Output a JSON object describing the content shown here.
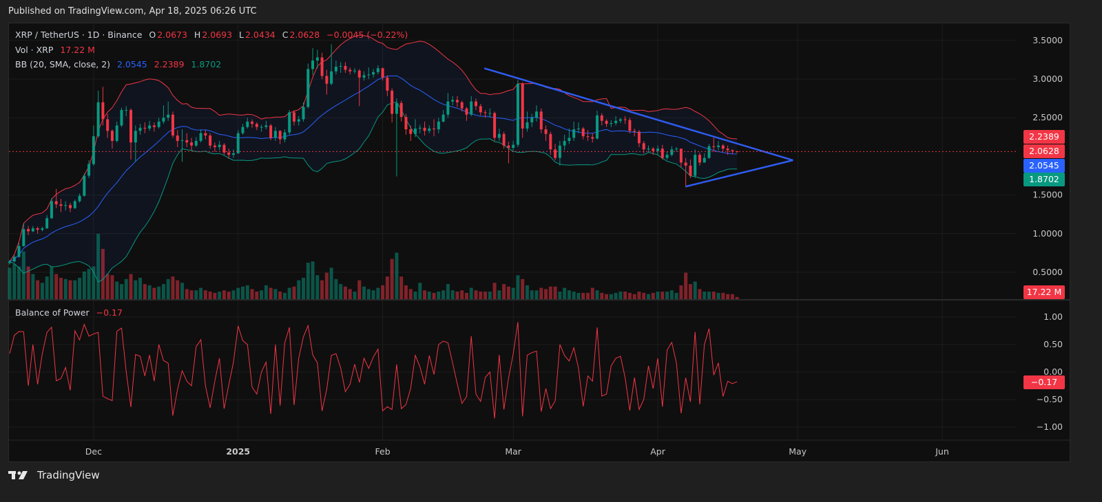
{
  "header": {
    "published": "Published on TradingView.com, Apr 18, 2025 06:26 UTC"
  },
  "legend": {
    "symbol": "XRP / TetherUS · 1D · Binance",
    "o_label": "O",
    "o_value": "2.0673",
    "h_label": "H",
    "h_value": "2.0693",
    "l_label": "L",
    "l_value": "2.0434",
    "c_label": "C",
    "c_value": "2.0628",
    "change": "−0.0045 (−0.22%)",
    "vol_label": "Vol · XRP",
    "vol_value": "17.22 M",
    "bb_label": "BB (20, SMA, close, 2)",
    "bb_basis": "2.0545",
    "bb_upper": "2.2389",
    "bb_lower": "1.8702",
    "bop_label": "Balance of Power",
    "bop_value": "−0.17"
  },
  "badges": {
    "upper": "2.2389",
    "close": "2.0628",
    "basis": "2.0545",
    "lower": "1.8702",
    "volume": "17.22 M",
    "bop": "−0.17"
  },
  "footer": {
    "brand": "TradingView"
  },
  "colors": {
    "up": "#089981",
    "down": "#f23645",
    "basis": "#2962ff",
    "trendline": "#2f5cf0"
  },
  "chart_data": {
    "type": "candlestick",
    "title": "XRP / TetherUS · 1D · Binance",
    "first_open": 0.62,
    "close": [
      0.64,
      0.7,
      0.84,
      1.06,
      1.03,
      1.07,
      1.05,
      1.07,
      1.2,
      1.42,
      1.38,
      1.36,
      1.37,
      1.33,
      1.42,
      1.49,
      1.75,
      1.9,
      2.26,
      2.7,
      2.48,
      2.33,
      2.2,
      2.4,
      2.6,
      2.6,
      2.18,
      2.33,
      2.37,
      2.36,
      2.4,
      2.38,
      2.45,
      2.5,
      2.54,
      2.27,
      2.2,
      2.21,
      2.18,
      2.14,
      2.2,
      2.3,
      2.27,
      2.14,
      2.12,
      2.15,
      2.05,
      2.02,
      2.04,
      2.3,
      2.38,
      2.45,
      2.42,
      2.38,
      2.38,
      2.4,
      2.24,
      2.33,
      2.22,
      2.31,
      2.57,
      2.45,
      2.48,
      2.64,
      3.13,
      3.24,
      3.28,
      3.04,
      2.94,
      3.1,
      3.16,
      3.17,
      3.12,
      3.1,
      3.11,
      3.02,
      3.05,
      3.06,
      3.09,
      3.14,
      3.02,
      2.85,
      2.55,
      2.69,
      2.51,
      2.35,
      2.29,
      2.36,
      2.37,
      2.33,
      2.36,
      2.35,
      2.45,
      2.54,
      2.71,
      2.73,
      2.7,
      2.62,
      2.54,
      2.71,
      2.65,
      2.57,
      2.56,
      2.56,
      2.24,
      2.29,
      2.14,
      2.11,
      2.15,
      2.94,
      2.36,
      2.44,
      2.5,
      2.58,
      2.35,
      2.29,
      2.09,
      1.98,
      2.14,
      2.2,
      2.24,
      2.35,
      2.36,
      2.26,
      2.25,
      2.23,
      2.53,
      2.46,
      2.42,
      2.43,
      2.46,
      2.48,
      2.47,
      2.33,
      2.32,
      2.17,
      2.09,
      2.1,
      2.07,
      2.1,
      1.98,
      2.02,
      2.09,
      2.1,
      1.92,
      1.88,
      1.75,
      2.02,
      1.92,
      1.98,
      2.13,
      2.12,
      2.14,
      2.1,
      2.08,
      2.0673,
      2.0628
    ],
    "high": [
      0.66,
      0.72,
      0.88,
      1.13,
      1.1,
      1.1,
      1.09,
      1.09,
      1.24,
      1.46,
      1.58,
      1.45,
      1.42,
      1.4,
      1.44,
      1.52,
      1.78,
      1.95,
      2.4,
      2.85,
      2.9,
      2.55,
      2.35,
      2.45,
      2.63,
      2.65,
      2.62,
      2.4,
      2.42,
      2.44,
      2.46,
      2.44,
      2.5,
      2.66,
      2.71,
      2.58,
      2.34,
      2.35,
      2.3,
      2.24,
      2.25,
      2.35,
      2.34,
      2.3,
      2.18,
      2.2,
      2.17,
      2.1,
      2.09,
      2.34,
      2.42,
      2.5,
      2.48,
      2.44,
      2.41,
      2.46,
      2.42,
      2.38,
      2.34,
      2.35,
      2.6,
      2.6,
      2.52,
      2.7,
      3.2,
      3.4,
      3.38,
      3.34,
      3.12,
      3.45,
      3.24,
      3.22,
      3.22,
      3.15,
      3.14,
      3.13,
      3.1,
      3.15,
      3.13,
      3.18,
      3.15,
      3.05,
      2.88,
      2.75,
      2.72,
      2.55,
      2.4,
      2.48,
      2.41,
      2.45,
      2.4,
      2.48,
      2.5,
      2.6,
      2.82,
      2.78,
      2.78,
      2.72,
      2.64,
      2.78,
      2.75,
      2.68,
      2.6,
      2.62,
      2.58,
      2.36,
      2.32,
      2.19,
      2.2,
      2.99,
      2.96,
      2.58,
      2.55,
      2.66,
      2.62,
      2.4,
      2.32,
      2.16,
      2.2,
      2.28,
      2.36,
      2.45,
      2.44,
      2.38,
      2.34,
      2.3,
      2.59,
      2.56,
      2.48,
      2.47,
      2.52,
      2.5,
      2.52,
      2.5,
      2.36,
      2.34,
      2.2,
      2.14,
      2.12,
      2.14,
      2.15,
      2.06,
      2.13,
      2.12,
      2.1,
      1.98,
      1.96,
      2.09,
      2.05,
      2.04,
      2.16,
      2.24,
      2.2,
      2.16,
      2.14,
      2.09,
      2.0693
    ],
    "low": [
      0.6,
      0.63,
      0.69,
      0.83,
      0.98,
      1.02,
      1.0,
      1.03,
      1.06,
      1.19,
      1.33,
      1.28,
      1.3,
      1.28,
      1.32,
      1.4,
      1.48,
      1.72,
      1.88,
      2.24,
      2.4,
      2.24,
      2.1,
      2.18,
      2.38,
      2.52,
      1.96,
      1.93,
      2.28,
      2.3,
      2.33,
      2.32,
      2.36,
      2.42,
      2.46,
      2.24,
      2.12,
      1.93,
      2.12,
      2.08,
      2.12,
      2.18,
      2.22,
      2.1,
      2.06,
      2.08,
      2.02,
      1.97,
      1.98,
      2.03,
      2.28,
      2.36,
      2.37,
      2.34,
      2.32,
      2.35,
      2.21,
      2.2,
      2.16,
      2.18,
      2.28,
      2.4,
      2.4,
      2.45,
      2.62,
      3.05,
      3.14,
      3.0,
      2.8,
      2.92,
      3.06,
      3.08,
      3.08,
      3.06,
      3.07,
      2.65,
      2.98,
      3.0,
      3.02,
      3.06,
      2.98,
      2.78,
      2.44,
      1.74,
      2.45,
      2.28,
      2.2,
      2.25,
      2.3,
      2.27,
      2.3,
      2.26,
      2.3,
      2.44,
      2.5,
      2.66,
      2.64,
      2.58,
      2.46,
      2.52,
      2.6,
      2.53,
      2.5,
      2.5,
      2.2,
      2.2,
      2.1,
      1.91,
      2.08,
      2.12,
      2.24,
      2.32,
      2.38,
      2.45,
      2.3,
      2.2,
      2.02,
      1.95,
      1.88,
      2.08,
      2.16,
      2.2,
      2.3,
      2.22,
      2.2,
      2.18,
      2.22,
      2.4,
      2.38,
      2.38,
      2.4,
      2.43,
      2.42,
      2.3,
      2.26,
      2.12,
      2.04,
      2.05,
      2.02,
      2.02,
      1.96,
      1.96,
      2.0,
      2.06,
      1.86,
      1.6,
      1.72,
      1.72,
      1.88,
      1.92,
      1.97,
      2.06,
      2.08,
      2.07,
      2.02,
      2.03,
      2.0434
    ],
    "volume_m": [
      250,
      280,
      260,
      380,
      260,
      200,
      150,
      130,
      180,
      260,
      200,
      170,
      160,
      150,
      150,
      170,
      220,
      240,
      260,
      520,
      400,
      200,
      190,
      140,
      120,
      160,
      200,
      150,
      170,
      120,
      110,
      90,
      100,
      120,
      160,
      180,
      150,
      130,
      80,
      70,
      70,
      90,
      70,
      60,
      50,
      60,
      70,
      60,
      70,
      90,
      100,
      110,
      80,
      60,
      70,
      110,
      90,
      80,
      60,
      50,
      90,
      100,
      150,
      170,
      290,
      300,
      190,
      150,
      210,
      250,
      160,
      120,
      100,
      80,
      60,
      150,
      100,
      80,
      70,
      90,
      110,
      180,
      320,
      370,
      180,
      110,
      80,
      60,
      130,
      70,
      60,
      50,
      60,
      70,
      120,
      70,
      60,
      70,
      50,
      90,
      70,
      60,
      60,
      60,
      130,
      70,
      120,
      100,
      90,
      190,
      160,
      110,
      70,
      70,
      90,
      80,
      100,
      100,
      60,
      90,
      70,
      60,
      50,
      50,
      50,
      90,
      70,
      50,
      40,
      40,
      50,
      60,
      60,
      50,
      40,
      60,
      50,
      40,
      50,
      60,
      60,
      60,
      70,
      50,
      110,
      210,
      120,
      140,
      80,
      60,
      60,
      60,
      50,
      50,
      40,
      40,
      17.22
    ],
    "indicators": {
      "bollinger": {
        "length": 20,
        "mult": 2,
        "basis": 2.0545,
        "upper": 2.2389,
        "lower": 1.8702
      },
      "balance_of_power_last": -0.17
    },
    "y_ticks": [
      "3.5000",
      "3.0000",
      "2.5000",
      "1.5000",
      "1.0000",
      "0.5000"
    ],
    "bop_ticks": [
      "1.00",
      "0.50",
      "0.00",
      "−0.50",
      "−1.00"
    ],
    "bop_tick_values": [
      1,
      0.5,
      0,
      -0.5,
      -1
    ],
    "ylim": [
      0.5,
      3.5
    ],
    "x_ticks": [
      {
        "label": "Dec",
        "day": 18,
        "bold": false
      },
      {
        "label": "2025",
        "day": 49,
        "bold": true
      },
      {
        "label": "Feb",
        "day": 80,
        "bold": false
      },
      {
        "label": "Mar",
        "day": 108,
        "bold": false
      },
      {
        "label": "Apr",
        "day": 139,
        "bold": false
      },
      {
        "label": "May",
        "day": 169,
        "bold": false
      },
      {
        "label": "Jun",
        "day": 200,
        "bold": false
      }
    ],
    "trendlines": [
      {
        "from": {
          "day": 101.8,
          "price": 3.14
        },
        "to": {
          "day": 168,
          "price": 1.95
        }
      },
      {
        "from": {
          "day": 145,
          "price": 1.61
        },
        "to": {
          "day": 168,
          "price": 1.95
        }
      }
    ],
    "last_close": 2.0628
  }
}
